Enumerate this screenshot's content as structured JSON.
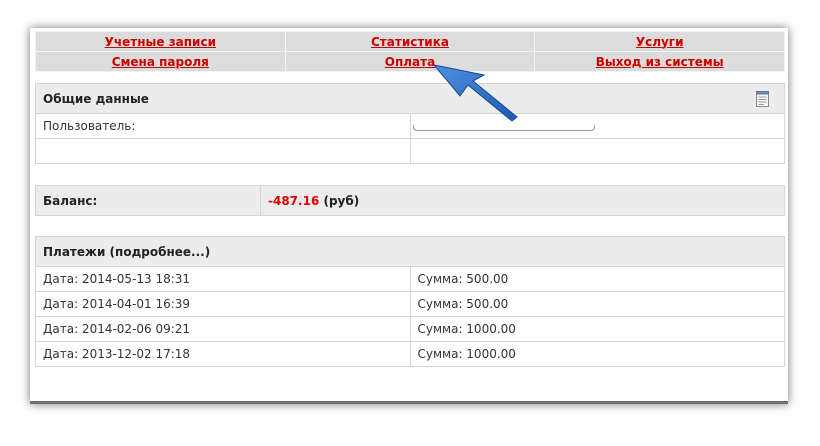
{
  "nav": {
    "row1": [
      "Учетные записи",
      "Статистика",
      "Услуги"
    ],
    "row2": [
      "Смена пароля",
      "Оплата",
      "Выход из системы"
    ]
  },
  "general": {
    "title": "Общие данные",
    "user_label": "Пользователь:",
    "user_value": ""
  },
  "balance": {
    "label": "Баланс:",
    "amount": "-487.16",
    "currency": "(руб)"
  },
  "payments": {
    "title": "Платежи (подробнее...)",
    "rows": [
      {
        "date": "Дата: 2014-05-13 18:31",
        "sum": "Сумма: 500.00"
      },
      {
        "date": "Дата: 2014-04-01 16:39",
        "sum": "Сумма: 500.00"
      },
      {
        "date": "Дата: 2014-02-06 09:21",
        "sum": "Сумма: 1000.00"
      },
      {
        "date": "Дата: 2013-12-02 17:18",
        "sum": "Сумма: 1000.00"
      }
    ]
  },
  "colors": {
    "link": "#cc0000",
    "negative": "#dd0000",
    "header_bg": "#ececec",
    "nav_bg": "#dcdcdc",
    "arrow": "#2d6bc4"
  },
  "icons": {
    "notes": "notepad-icon",
    "pointer": "arrow-pointer"
  }
}
